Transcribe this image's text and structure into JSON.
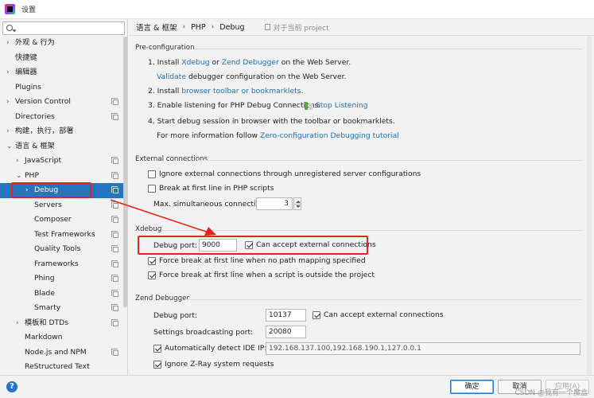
{
  "window": {
    "title": "设置"
  },
  "search": {
    "placeholder": "",
    "value": ""
  },
  "sidebar": {
    "items": [
      {
        "label": "外观 & 行为",
        "arrow": "›",
        "level": 0,
        "settings": false
      },
      {
        "label": "快捷键",
        "arrow": "",
        "level": 0,
        "settings": false
      },
      {
        "label": "编辑器",
        "arrow": "›",
        "level": 0,
        "settings": false
      },
      {
        "label": "Plugins",
        "arrow": "",
        "level": 0,
        "settings": false
      },
      {
        "label": "Version Control",
        "arrow": "›",
        "level": 0,
        "settings": true
      },
      {
        "label": "Directories",
        "arrow": "",
        "level": 0,
        "settings": true
      },
      {
        "label": "构建，执行，部署",
        "arrow": "›",
        "level": 0,
        "settings": false
      },
      {
        "label": "语言 & 框架",
        "arrow": "⌄",
        "level": 0,
        "settings": false
      },
      {
        "label": "JavaScript",
        "arrow": "›",
        "level": 1,
        "settings": true
      },
      {
        "label": "PHP",
        "arrow": "⌄",
        "level": 1,
        "settings": true
      },
      {
        "label": "Debug",
        "arrow": "›",
        "level": 2,
        "settings": true,
        "selected": true
      },
      {
        "label": "Servers",
        "arrow": "",
        "level": 2,
        "settings": true
      },
      {
        "label": "Composer",
        "arrow": "",
        "level": 2,
        "settings": true
      },
      {
        "label": "Test Frameworks",
        "arrow": "",
        "level": 2,
        "settings": true
      },
      {
        "label": "Quality Tools",
        "arrow": "",
        "level": 2,
        "settings": true
      },
      {
        "label": "Frameworks",
        "arrow": "",
        "level": 2,
        "settings": true
      },
      {
        "label": "Phing",
        "arrow": "",
        "level": 2,
        "settings": true
      },
      {
        "label": "Blade",
        "arrow": "",
        "level": 2,
        "settings": true
      },
      {
        "label": "Smarty",
        "arrow": "",
        "level": 2,
        "settings": true
      },
      {
        "label": "模板和 DTDs",
        "arrow": "›",
        "level": 1,
        "settings": true
      },
      {
        "label": "Markdown",
        "arrow": "",
        "level": 1,
        "settings": false
      },
      {
        "label": "Node.js and NPM",
        "arrow": "",
        "level": 1,
        "settings": true
      },
      {
        "label": "ReStructured Text",
        "arrow": "",
        "level": 1,
        "settings": false
      }
    ]
  },
  "header": {
    "crumbs": [
      "语言 & 框架",
      "PHP",
      "Debug"
    ],
    "separator": "›",
    "project_scope": "对于当前 project"
  },
  "preconfig": {
    "title": "Pre-configuration",
    "s1_a": "1. Install ",
    "s1_link1": "Xdebug",
    "s1_b": " or ",
    "s1_link2": "Zend Debugger",
    "s1_c": " on the Web Server.",
    "s1_validate": "Validate",
    "s1_d": " debugger configuration on the Web Server.",
    "s2_a": "2. Install ",
    "s2_link": "browser toolbar or bookmarklets.",
    "s3_a": "3. Enable listening for PHP Debug Connections:",
    "s3_link": "Stop Listening",
    "s4_a": "4. Start debug session in browser with the toolbar or bookmarklets.",
    "s4_b": "For more information follow ",
    "s4_link": "Zero-configuration Debugging tutorial"
  },
  "external": {
    "title": "External connections",
    "ignore_label": "Ignore external connections through unregistered server configurations",
    "ignore_checked": false,
    "break_label": "Break at first line in PHP scripts",
    "break_checked": false,
    "max_label": "Max. simultaneous connections:",
    "max_value": "3"
  },
  "xdebug": {
    "title": "Xdebug",
    "port_label": "Debug port:",
    "port_value": "9000",
    "accept_label": "Can accept external connections",
    "accept_checked": true,
    "force_nomap_label": "Force break at first line when no path mapping specified",
    "force_nomap_checked": true,
    "force_outside_label": "Force break at first line when a script is outside the project",
    "force_outside_checked": true
  },
  "zend": {
    "title": "Zend Debugger",
    "port_label": "Debug port:",
    "port_value": "10137",
    "accept_label": "Can accept external connections",
    "accept_checked": true,
    "broadcast_label": "Settings broadcasting port:",
    "broadcast_value": "20080",
    "auto_ip_label": "Automatically detect IDE IP:",
    "auto_ip_checked": true,
    "auto_ip_value": "192.168.137.100,192.168.190.1,127.0.0.1",
    "zray_label": "Ignore Z-Ray system requests",
    "zray_checked": true
  },
  "footer": {
    "help": "?",
    "ok": "确定",
    "cancel": "取消",
    "apply": "应用(A)",
    "watermark": "CSDN @我有一个魔盒"
  },
  "colors": {
    "accent": "#2675bf",
    "link": "#2470b3",
    "highlight": "#e0251b"
  }
}
